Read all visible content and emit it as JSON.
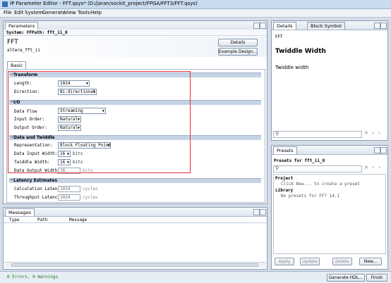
{
  "window": {
    "title": "IP Parameter Editor - FFT.qsys* (D:/jaran/sockit_project/FPGA/FFT3/FFT.qsys)"
  },
  "menu": [
    "File",
    "Edit",
    "System",
    "Generate",
    "View",
    "Tools",
    "Help"
  ],
  "params_panel": {
    "tab": "Parameters",
    "system_label": "System: FF",
    "path_label": "Path: fft_ii_0",
    "component_title": "FFT",
    "component_sub": "altera_fft_ii",
    "details_button": "Details",
    "example_button": "Example Design...",
    "basic_tab": "Basic",
    "transform": {
      "header": "Transform",
      "length_label": "Length:",
      "length_value": "1024",
      "direction_label": "Direction:",
      "direction_value": "Bi-directional"
    },
    "io": {
      "header": "I/O",
      "data_flow_label": "Data Flow",
      "data_flow_value": "Streaming",
      "input_order_label": "Input Order:",
      "input_order_value": "Natural",
      "output_order_label": "Output Order:",
      "output_order_value": "Natural"
    },
    "data_twiddle": {
      "header": "Data and Twiddle",
      "representation_label": "Representation:",
      "representation_value": "Block Floating Point",
      "data_input_label": "Data Input Width:",
      "data_input_value": "16",
      "twiddle_label": "Twiddle Width:",
      "twiddle_value": "16",
      "data_output_label": "Data Output Width:",
      "data_output_value": "16",
      "unit": "bits"
    },
    "latency": {
      "header": "Latency Estimates",
      "calc_label": "Calculation Latency:",
      "calc_value": "1024",
      "thru_label": "Throughput Latency:",
      "thru_value": "1024",
      "unit": "cycles"
    }
  },
  "details_panel": {
    "tab1": "Details",
    "tab2": "Block Symbol",
    "name": "FFT",
    "heading": "Twiddle Width",
    "desc": "Twiddle width"
  },
  "presets_panel": {
    "tab": "Presets",
    "for_label": "Presets for fft_ii_0",
    "project_label": "Project",
    "project_hint": "Click New... to create a preset",
    "library_label": "Library",
    "library_hint": "No presets for FFT 14.1",
    "apply": "Apply",
    "update": "Update",
    "delete": "Delete",
    "new": "New..."
  },
  "messages_panel": {
    "tab": "Messages",
    "columns": [
      "Type",
      "Path",
      "Message"
    ]
  },
  "status": {
    "errors": "0 Errors, 0 Warnings",
    "generate": "Generate HDL...",
    "finish": "Finish"
  }
}
